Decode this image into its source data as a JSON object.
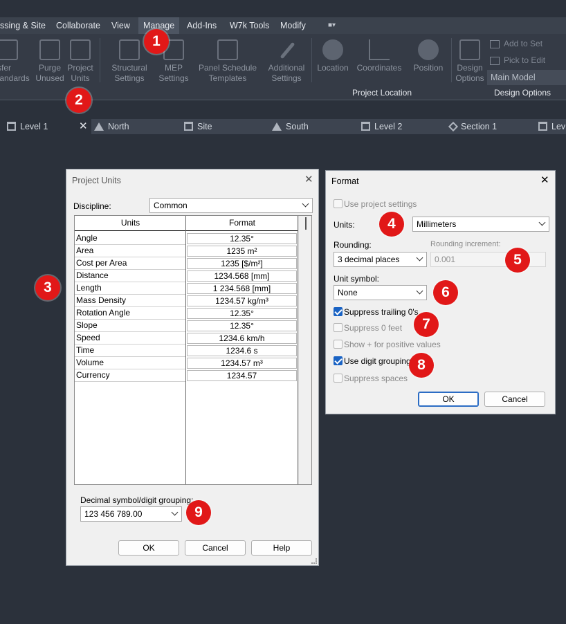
{
  "menu": {
    "items": [
      "ssing & Site",
      "Collaborate",
      "View",
      "Manage",
      "Add-Ins",
      "W7k Tools",
      "Modify"
    ]
  },
  "ribbon": {
    "buttons": {
      "transfer_standards": "sfer\ntandards",
      "purge_unused": "Purge\nUnused",
      "project_units": "Project\nUnits",
      "structural_settings": "Structural\nSettings",
      "mep_settings": "MEP\nSettings",
      "panel_schedule_templates": "Panel Schedule\nTemplates",
      "additional_settings": "Additional\nSettings",
      "location": "Location",
      "coordinates": "Coordinates",
      "position": "Position",
      "design_options": "Design\nOptions"
    },
    "add_to_set": "Add to Set",
    "pick_to_edit": "Pick to Edit",
    "main_model": "Main Model",
    "panel_project_location": "Project Location",
    "panel_design_options": "Design Options"
  },
  "tabs": [
    {
      "label": "Level 1",
      "icon": "floor-plan-icon"
    },
    {
      "label": "North",
      "icon": "elevation-icon"
    },
    {
      "label": "Site",
      "icon": "floor-plan-icon"
    },
    {
      "label": "South",
      "icon": "elevation-icon"
    },
    {
      "label": "Level 2",
      "icon": "floor-plan-icon"
    },
    {
      "label": "Section 1",
      "icon": "section-icon"
    },
    {
      "label": "Lev",
      "icon": "floor-plan-icon"
    }
  ],
  "project_units": {
    "title": "Project Units",
    "discipline_label": "Discipline:",
    "discipline_value": "Common",
    "col_units": "Units",
    "col_format": "Format",
    "rows": [
      {
        "unit": "Angle",
        "format": "12.35°"
      },
      {
        "unit": "Area",
        "format": "1235 m²"
      },
      {
        "unit": "Cost per Area",
        "format": "1235 [$/m²]"
      },
      {
        "unit": "Distance",
        "format": "1234.568 [mm]"
      },
      {
        "unit": "Length",
        "format": "1 234.568 [mm]"
      },
      {
        "unit": "Mass Density",
        "format": "1234.57 kg/m³"
      },
      {
        "unit": "Rotation Angle",
        "format": "12.35°"
      },
      {
        "unit": "Slope",
        "format": "12.35°"
      },
      {
        "unit": "Speed",
        "format": "1234.6 km/h"
      },
      {
        "unit": "Time",
        "format": "1234.6 s"
      },
      {
        "unit": "Volume",
        "format": "1234.57 m³"
      },
      {
        "unit": "Currency",
        "format": "1234.57"
      }
    ],
    "decimal_label": "Decimal symbol/digit grouping:",
    "decimal_value": "123 456 789.00",
    "ok": "OK",
    "cancel": "Cancel",
    "help": "Help"
  },
  "format": {
    "title": "Format",
    "use_project_settings": "Use project settings",
    "units_label": "Units:",
    "units_value": "Millimeters",
    "rounding_label": "Rounding:",
    "rounding_value": "3 decimal places",
    "rounding_increment_label": "Rounding increment:",
    "rounding_increment_value": "0.001",
    "unit_symbol_label": "Unit symbol:",
    "unit_symbol_value": "None",
    "suppress_trailing": "Suppress trailing 0's",
    "suppress_feet": "Suppress 0 feet",
    "show_plus": "Show + for positive values",
    "digit_grouping": "Use digit grouping",
    "suppress_spaces": "Suppress spaces",
    "ok": "OK",
    "cancel": "Cancel"
  },
  "callouts": [
    "1",
    "2",
    "3",
    "4",
    "5",
    "6",
    "7",
    "8",
    "9"
  ],
  "colors": {
    "background": "#2b313b",
    "ribbon": "#353b46",
    "callout": "#e11818",
    "checkbox_on": "#1a63c4"
  }
}
